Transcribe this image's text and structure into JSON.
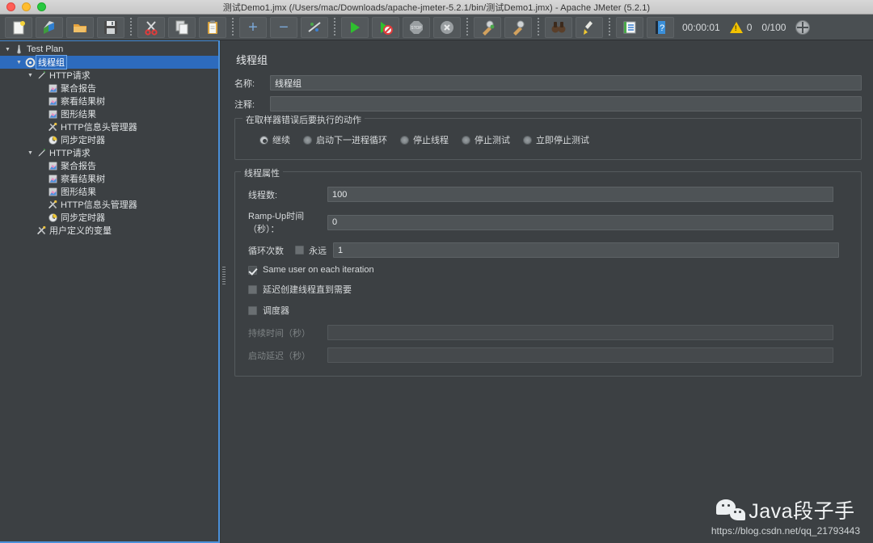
{
  "window": {
    "title": "测试Demo1.jmx (/Users/mac/Downloads/apache-jmeter-5.2.1/bin/测试Demo1.jmx) - Apache JMeter (5.2.1)",
    "controls": {
      "close": "close-button",
      "minimize": "minimize-button",
      "maximize": "maximize-button"
    }
  },
  "toolbar": {
    "buttons": [
      {
        "name": "new-button",
        "icon": "new-document-icon"
      },
      {
        "name": "templates-button",
        "icon": "templates-icon"
      },
      {
        "name": "open-button",
        "icon": "open-folder-icon"
      },
      {
        "name": "save-button",
        "icon": "floppy-save-icon"
      },
      {
        "name": "cut-button",
        "icon": "scissors-icon"
      },
      {
        "name": "copy-button",
        "icon": "copy-icon"
      },
      {
        "name": "paste-button",
        "icon": "clipboard-paste-icon"
      },
      {
        "name": "expand-all-button",
        "icon": "plus-icon",
        "glyph": "+"
      },
      {
        "name": "collapse-all-button",
        "icon": "minus-icon",
        "glyph": "−"
      },
      {
        "name": "toggle-button",
        "icon": "toggle-pencil-icon"
      },
      {
        "name": "start-button",
        "icon": "play-green-icon"
      },
      {
        "name": "start-no-pauses-button",
        "icon": "play-no-pause-icon"
      },
      {
        "name": "stop-button",
        "icon": "stop-octagon-icon"
      },
      {
        "name": "shutdown-button",
        "icon": "shutdown-circle-icon"
      },
      {
        "name": "clear-button",
        "icon": "clear-broom-icon"
      },
      {
        "name": "clear-all-button",
        "icon": "clear-all-broom-icon"
      },
      {
        "name": "search-button",
        "icon": "binoculars-icon"
      },
      {
        "name": "reset-search-button",
        "icon": "broom-yellow-icon"
      },
      {
        "name": "function-helper-button",
        "icon": "function-list-icon"
      },
      {
        "name": "help-button",
        "icon": "help-book-icon"
      }
    ],
    "status": {
      "elapsed": "00:00:01",
      "warning_count": "0",
      "threads": "0/100"
    },
    "accent_color": "#4a90d9"
  },
  "tree": {
    "items": [
      {
        "label": "Test Plan",
        "depth": 0,
        "twisty": "▼",
        "icon": "test-plan-icon",
        "selected": false
      },
      {
        "label": "线程组",
        "depth": 1,
        "twisty": "▼",
        "icon": "thread-group-gear-icon",
        "selected": true
      },
      {
        "label": "HTTP请求",
        "depth": 2,
        "twisty": "▼",
        "icon": "http-request-pencil-icon",
        "selected": false
      },
      {
        "label": "聚合报告",
        "depth": 3,
        "twisty": "",
        "icon": "aggregate-report-chart-icon",
        "selected": false
      },
      {
        "label": "察看结果树",
        "depth": 3,
        "twisty": "",
        "icon": "view-results-tree-chart-icon",
        "selected": false
      },
      {
        "label": "图形结果",
        "depth": 3,
        "twisty": "",
        "icon": "graph-results-chart-icon",
        "selected": false
      },
      {
        "label": "HTTP信息头管理器",
        "depth": 3,
        "twisty": "",
        "icon": "header-manager-tools-icon",
        "selected": false
      },
      {
        "label": "同步定时器",
        "depth": 3,
        "twisty": "",
        "icon": "sync-timer-clock-icon",
        "selected": false
      },
      {
        "label": "HTTP请求",
        "depth": 2,
        "twisty": "▼",
        "icon": "http-request-pencil-icon",
        "selected": false
      },
      {
        "label": "聚合报告",
        "depth": 3,
        "twisty": "",
        "icon": "aggregate-report-chart-icon",
        "selected": false
      },
      {
        "label": "察看结果树",
        "depth": 3,
        "twisty": "",
        "icon": "view-results-tree-chart-icon",
        "selected": false
      },
      {
        "label": "图形结果",
        "depth": 3,
        "twisty": "",
        "icon": "graph-results-chart-icon",
        "selected": false
      },
      {
        "label": "HTTP信息头管理器",
        "depth": 3,
        "twisty": "",
        "icon": "header-manager-tools-icon",
        "selected": false
      },
      {
        "label": "同步定时器",
        "depth": 3,
        "twisty": "",
        "icon": "sync-timer-clock-icon",
        "selected": false
      },
      {
        "label": "用户定义的变量",
        "depth": 2,
        "twisty": "",
        "icon": "user-defined-variables-tools-icon",
        "selected": false
      }
    ]
  },
  "panel": {
    "title": "线程组",
    "name_label": "名称:",
    "name_value": "线程组",
    "comment_label": "注释:",
    "comment_value": "",
    "error_action": {
      "legend": "在取样器错误后要执行的动作",
      "options": [
        {
          "label": "继续",
          "selected": true
        },
        {
          "label": "启动下一进程循环",
          "selected": false
        },
        {
          "label": "停止线程",
          "selected": false
        },
        {
          "label": "停止测试",
          "selected": false
        },
        {
          "label": "立即停止测试",
          "selected": false
        }
      ]
    },
    "thread_properties": {
      "legend": "线程属性",
      "num_threads_label": "线程数:",
      "num_threads_value": "100",
      "ramp_up_label": "Ramp-Up时间（秒）：",
      "ramp_up_value": "0",
      "loop_count_label": "循环次数",
      "forever_label": "永远",
      "forever_checked": false,
      "loop_count_value": "1",
      "same_user_label": "Same user on each iteration",
      "same_user_checked": true,
      "delay_thread_label": "延迟创建线程直到需要",
      "delay_thread_checked": false,
      "scheduler_label": "调度器",
      "scheduler_checked": false,
      "duration_label": "持续时间（秒）",
      "duration_value": "",
      "startup_delay_label": "启动延迟（秒）",
      "startup_delay_value": ""
    }
  },
  "watermark": {
    "brand": "Java段子手",
    "url": "https://blog.csdn.net/qq_21793443",
    "icon": "wechat-icon"
  }
}
